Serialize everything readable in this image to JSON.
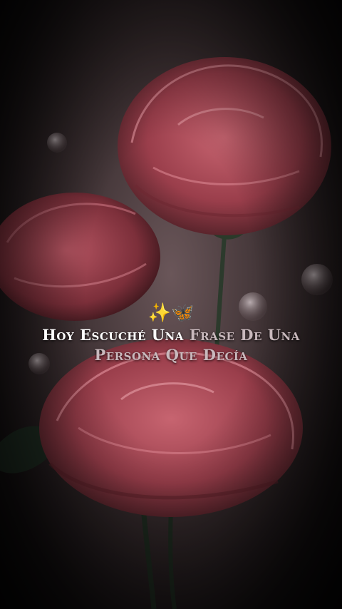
{
  "caption": {
    "emoji": "✨🦋",
    "line1_white": "Hoy Escuché Una",
    "line1_dim": "Frase De Una",
    "line2": "Persona Que Decía"
  },
  "colors": {
    "white_text": "#ffffff",
    "dim_text": "#c9b9bd",
    "rose": "#b8515e",
    "background": "#3b2f31"
  }
}
